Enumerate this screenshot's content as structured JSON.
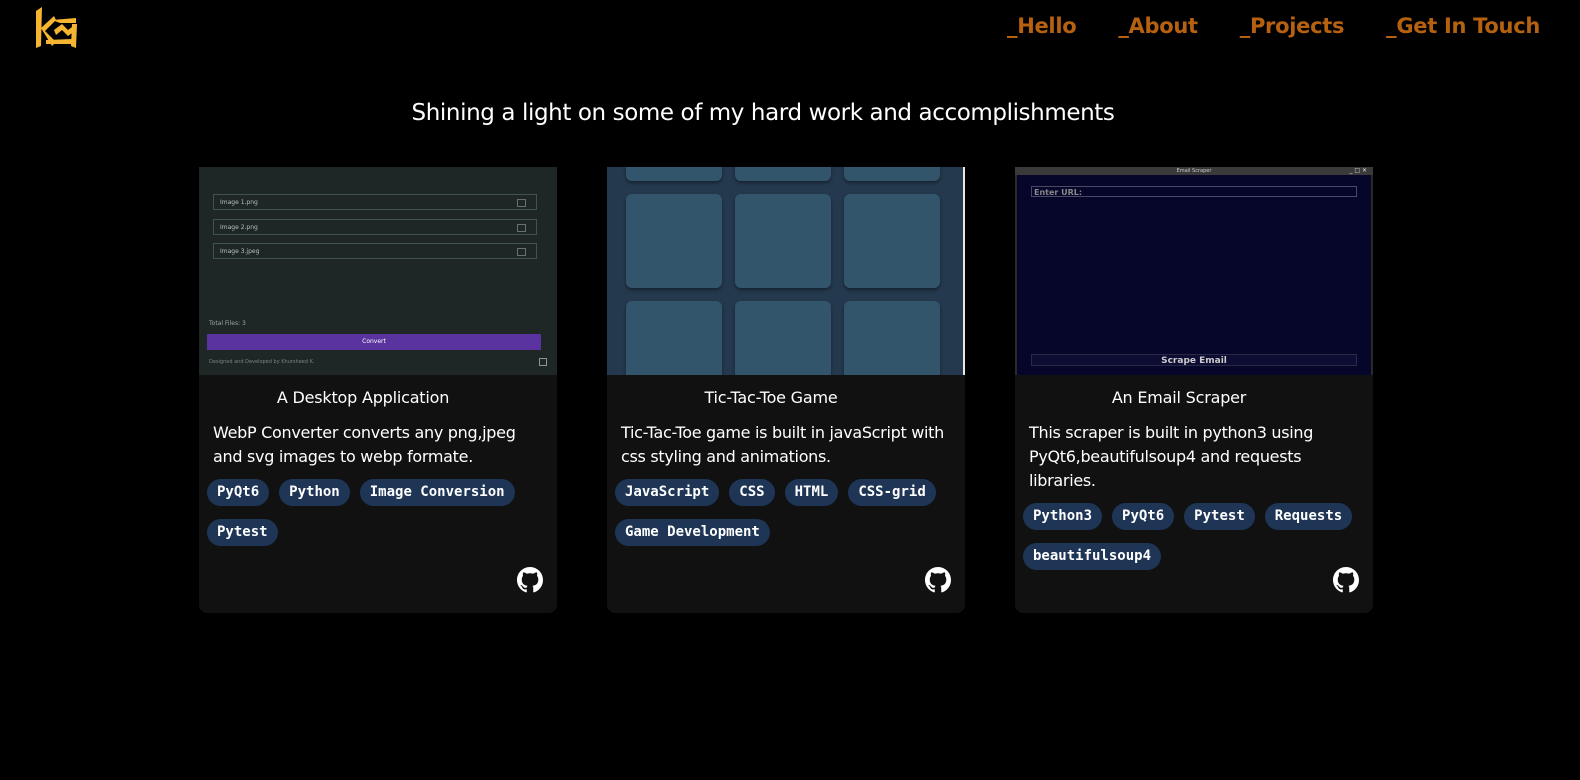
{
  "nav": {
    "items": [
      {
        "label": "_Hello"
      },
      {
        "label": "_About"
      },
      {
        "label": "_Projects"
      },
      {
        "label": "_Get In Touch"
      }
    ]
  },
  "headline": "Shining a light on some of my hard work and accomplishments",
  "colors": {
    "background": "#000000",
    "accent": "#b5610f",
    "logo": "#f5b531",
    "card": "#111111",
    "tag_bg": "#1e3556"
  },
  "projects": [
    {
      "title": "A Desktop Application",
      "description": "WebP Converter converts any png,jpeg and svg images to webp formate.",
      "tags": [
        "PyQt6",
        "Python",
        "Image Conversion",
        "Pytest"
      ],
      "link_icon": "github-icon",
      "screenshot": {
        "files": [
          "Image 1.png",
          "Image 2.png",
          "Image 3.jpeg"
        ],
        "total": "Total Files: 3",
        "button": "Convert",
        "credit": "Designed and Developed by Khursheed K."
      }
    },
    {
      "title": "Tic-Tac-Toe Game",
      "description": "Tic-Tac-Toe game is built in javaScript with css styling and animations.",
      "tags": [
        "JavaScript",
        "CSS",
        "HTML",
        "CSS-grid",
        "Game Development"
      ],
      "link_icon": "github-icon"
    },
    {
      "title": "An Email Scraper",
      "description": "This scraper is built in python3 using PyQt6,beautifulsoup4 and requests libraries.",
      "tags": [
        "Python3",
        "PyQt6",
        "Pytest",
        "Requests",
        "beautifulsoup4"
      ],
      "link_icon": "github-icon",
      "screenshot": {
        "window_title": "Email Scraper",
        "window_buttons": "_ □ ✕",
        "url_label": "Enter URL:",
        "button": "Scrape Email"
      }
    }
  ]
}
